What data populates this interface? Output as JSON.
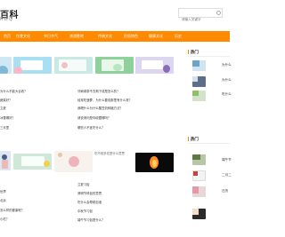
{
  "header": {
    "logo": "百科",
    "logo_en": "KDQ",
    "search_placeholder": "请输入关键字"
  },
  "nav": [
    {
      "label": "首页"
    },
    {
      "label": "饮食文化"
    },
    {
      "label": "节日节气"
    },
    {
      "label": "旅游胜地"
    },
    {
      "label": "传统文化"
    },
    {
      "label": "民俗特色"
    },
    {
      "label": "健康文化"
    },
    {
      "label": "历史"
    }
  ],
  "list_top_left": [
    "为什么不能大合收？",
    "蔬菜好？",
    "立夏",
    "冰雪哪好？"
  ],
  "list_top_right": [
    "牙刷绿茶不去剩下成是怎么的？",
    "经常吃菠萝，为什么要说那里有什么常？",
    "我喝什么为什么酸豆奶种植方法？",
    "请说请问是你收藏哪吗？"
  ],
  "list_extra_left": "三月里",
  "list_extra_right": "哪些人不宜吃什么？",
  "broken_image": "吃不到多花是什么意思",
  "list_bottom_left": [
    "世界",
    "北京",
    "怎么样的健康呢？",
    "小吃？"
  ],
  "list_bottom_right": [
    "立夏习俗",
    "清明节风俗的意思",
    "吃什么会帮助血液",
    "中秋节习俗",
    "端午节习俗是什么？"
  ],
  "sidebar": {
    "title1": "热门",
    "title2": "热门",
    "items_top": [
      "为什么",
      "为什么",
      "吃什么"
    ],
    "items_bottom": [
      "端午节",
      "二月二",
      "日历"
    ]
  },
  "colors": {
    "accent": "#ff8a00",
    "thumb1": "#a9dff2",
    "thumb2": "#c9e9e3",
    "thumb3": "#8fd19a",
    "thumb4": "#dcd6f0",
    "thumb5": "#d9cfe6"
  }
}
